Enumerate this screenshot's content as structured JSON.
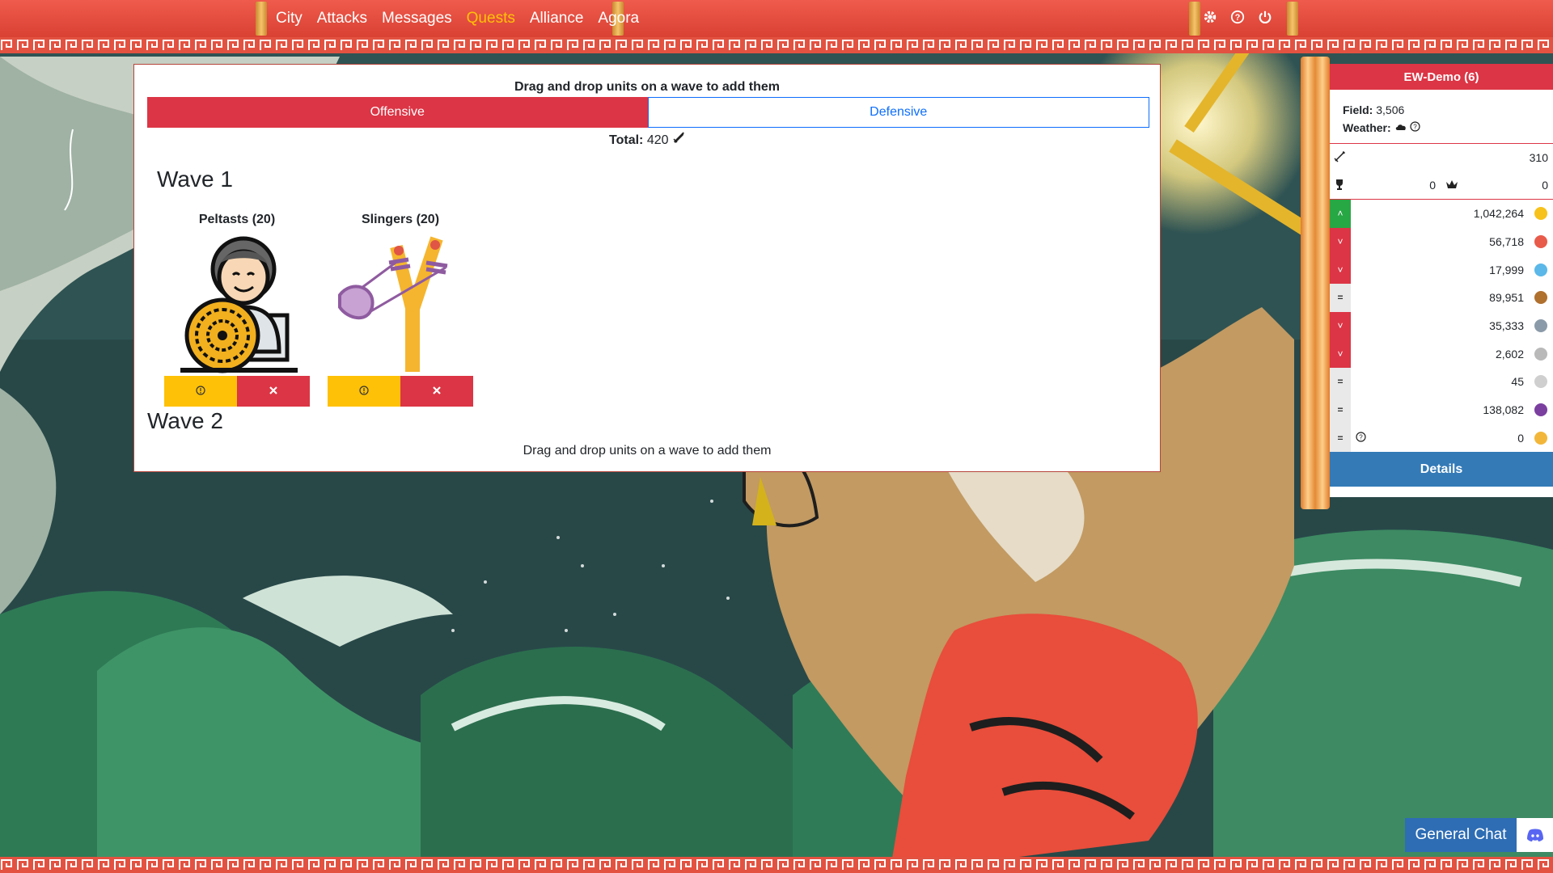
{
  "nav": {
    "items": [
      {
        "label": "City",
        "active": false
      },
      {
        "label": "Attacks",
        "active": false
      },
      {
        "label": "Messages",
        "active": false
      },
      {
        "label": "Quests",
        "active": true
      },
      {
        "label": "Alliance",
        "active": false
      },
      {
        "label": "Agora",
        "active": false
      }
    ],
    "icons": [
      "gear-icon",
      "help-icon",
      "power-icon"
    ]
  },
  "panel": {
    "title": "Drag and drop units on a wave to add them",
    "tab_offensive": "Offensive",
    "tab_defensive": "Defensive",
    "total_label": "Total:",
    "total_value": "420",
    "waves": [
      {
        "title": "Wave 1",
        "units": [
          {
            "name": "Peltasts",
            "count": "(20)",
            "info_icon": "info-icon",
            "remove_icon": "close-icon"
          },
          {
            "name": "Slingers",
            "count": "(20)",
            "info_icon": "info-icon",
            "remove_icon": "close-icon"
          }
        ]
      },
      {
        "title": "Wave 2",
        "units": []
      }
    ],
    "hint": "Drag and drop units on a wave to add them"
  },
  "sidebar": {
    "title": "EW-Demo (6)",
    "field_label": "Field:",
    "field_value": "3,506",
    "weather_label": "Weather:",
    "attack_value": "310",
    "trophy_value": "0",
    "crown_value": "0",
    "resources": [
      {
        "trend": "up",
        "value": "1,042,264",
        "icon": "gold-coin-icon",
        "color": "#f7c21b"
      },
      {
        "trend": "down",
        "value": "56,718",
        "icon": "meat-icon",
        "color": "#e85b4a"
      },
      {
        "trend": "down",
        "value": "17,999",
        "icon": "water-drop-icon",
        "color": "#5bb8e8"
      },
      {
        "trend": "eq",
        "value": "89,951",
        "icon": "wood-icon",
        "color": "#b0702e"
      },
      {
        "trend": "down",
        "value": "35,333",
        "icon": "stone-icon",
        "color": "#8a9aa8"
      },
      {
        "trend": "down",
        "value": "2,602",
        "icon": "marble-icon",
        "color": "#b9b9b9"
      },
      {
        "trend": "eq",
        "value": "45",
        "icon": "silver-icon",
        "color": "#cfcfcf"
      },
      {
        "trend": "eq",
        "value": "138,082",
        "icon": "grapes-icon",
        "color": "#7b3fa0"
      },
      {
        "trend": "eq",
        "value": "0",
        "icon": "prayer-icon",
        "color": "#f2b73a",
        "help": true
      }
    ],
    "details_label": "Details"
  },
  "chat": {
    "label": "General Chat",
    "icon": "discord-icon"
  }
}
